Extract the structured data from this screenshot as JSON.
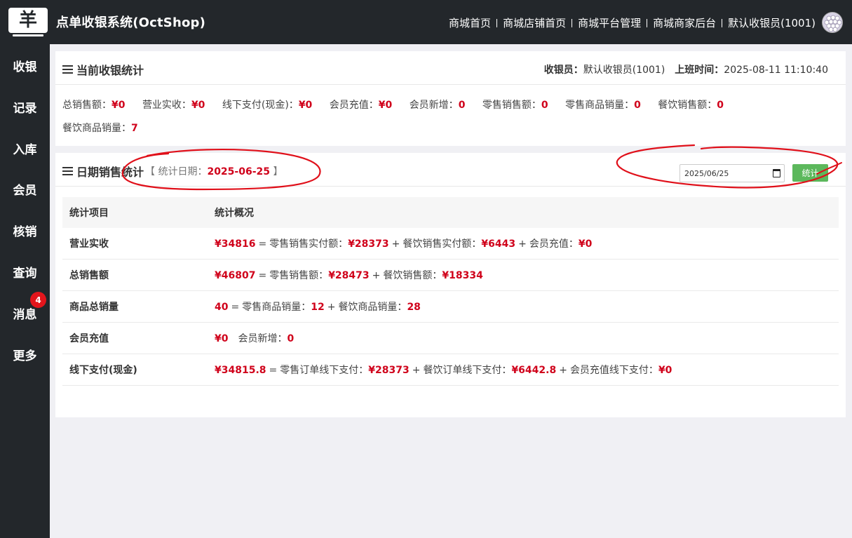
{
  "header": {
    "logo_glyph": "羊",
    "app_title": "点单收银系统(OctShop)",
    "nav": [
      "商城首页",
      "商城店铺首页",
      "商城平台管理",
      "商城商家后台",
      "默认收银员(1001)"
    ]
  },
  "sidebar": {
    "items": [
      {
        "label": "收银"
      },
      {
        "label": "记录"
      },
      {
        "label": "入库"
      },
      {
        "label": "会员"
      },
      {
        "label": "核销"
      },
      {
        "label": "查询"
      },
      {
        "label": "消息",
        "badge": "4"
      },
      {
        "label": "更多"
      }
    ]
  },
  "current": {
    "title": "当前收银统计",
    "cashier_label": "收银员：",
    "cashier_value": "默认收银员(1001)",
    "shift_label": "上班时间：",
    "shift_value": "2025-08-11 11:10:40",
    "stats": [
      {
        "label": "总销售额：",
        "value": "¥0"
      },
      {
        "label": "营业实收：",
        "value": "¥0"
      },
      {
        "label": "线下支付(现金)：",
        "value": "¥0"
      },
      {
        "label": "会员充值：",
        "value": "¥0"
      },
      {
        "label": "会员新增：",
        "value": "0"
      },
      {
        "label": "零售销售额：",
        "value": "0"
      },
      {
        "label": "零售商品销量：",
        "value": "0"
      },
      {
        "label": "餐饮销售额：",
        "value": "0"
      },
      {
        "label": "餐饮商品销量：",
        "value": "7"
      }
    ]
  },
  "daily": {
    "title": "日期销售统计",
    "bracket_open": "【",
    "date_label": "统计日期：",
    "date_value": "2025-06-25",
    "bracket_close": "】",
    "date_input": "2025/06/25",
    "button": "统计",
    "table": {
      "headers": [
        "统计项目",
        "统计概况"
      ],
      "rows": [
        {
          "item": "营业实收",
          "total": "¥34816",
          "eq": "=",
          "parts": [
            {
              "label": "零售销售实付额：",
              "value": "¥28373"
            },
            {
              "op": "+",
              "label": "餐饮销售实付额：",
              "value": "¥6443"
            },
            {
              "op": "+",
              "label": "会员充值：",
              "value": "¥0"
            }
          ]
        },
        {
          "item": "总销售额",
          "total": "¥46807",
          "eq": "=",
          "parts": [
            {
              "label": "零售销售额：",
              "value": "¥28473"
            },
            {
              "op": "+",
              "label": "餐饮销售额：",
              "value": "¥18334"
            }
          ]
        },
        {
          "item": "商品总销量",
          "total": "40",
          "eq": "=",
          "parts": [
            {
              "label": "零售商品销量：",
              "value": "12"
            },
            {
              "op": "+",
              "label": "餐饮商品销量：",
              "value": "28"
            }
          ]
        },
        {
          "item": "会员充值",
          "total": "¥0",
          "eq": "",
          "parts": [
            {
              "label": "会员新增：",
              "value": "0"
            }
          ]
        },
        {
          "item": "线下支付(现金)",
          "total": "¥34815.8",
          "eq": "=",
          "parts": [
            {
              "label": "零售订单线下支付：",
              "value": "¥28373"
            },
            {
              "op": "+",
              "label": "餐饮订单线下支付：",
              "value": "¥6442.8"
            },
            {
              "op": "+",
              "label": "会员充值线下支付：",
              "value": "¥0"
            }
          ]
        }
      ]
    }
  },
  "colors": {
    "header_bg": "#23272b",
    "accent_red": "#d0021b",
    "button_green": "#5cb85c",
    "annotation_red": "#e0101a"
  }
}
